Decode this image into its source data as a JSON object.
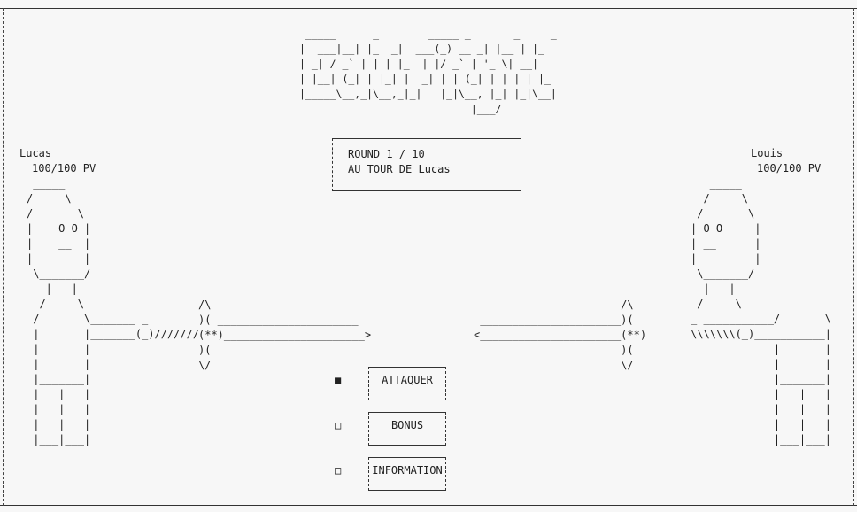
{
  "logo_ascii": " _____      _        _____ _       _     _\n|  ___|__| |_  _|  ___(_) __ _| |__ | |_\n| _| / _` | | | |_  | |/ _` | '_ \\| __|\n| |__| (_| | |_| |  _| | | (_| | | | | |_\n|_____\\__,_|\\__,_|_|   |_|\\__, |_| |_|\\__|\n                            |___/",
  "player_left": {
    "name": "Lucas",
    "hp": "100/100 PV"
  },
  "player_right": {
    "name": "Louis",
    "hp": "100/100 PV"
  },
  "round_box": {
    "line1": "ROUND 1 / 10",
    "line2": "AU TOUR DE Lucas"
  },
  "menu": [
    {
      "label": "ATTAQUER",
      "marker": "■",
      "selected": true
    },
    {
      "label": "BONUS",
      "marker": "□",
      "selected": false
    },
    {
      "label": "INFORMATION",
      "marker": "□",
      "selected": false
    }
  ],
  "art": {
    "left_fighter": " _____\n/     \\\n/       \\\n|    O O |\n|    __  |\n|        |\n \\_______/\n   |   |\n  /     \\\n /       \\_______ _\n |       |_______(_)///////\n |       |\n |       |\n |_______|\n |   |   |\n |   |   |\n |   |   |\n |___|___|",
    "right_fighter": "   _____\n  /     \\\n /       \\\n| O O     |\n| __      |\n|         |\n \\_______/\n  |   |\n /     \\\n_ ___________/       \\\n\\\\\\\\\\\\\\(_)___________|       |\n             |       |\n             |       |\n             |_______|\n             |   |   |\n             |   |   |\n             |   |   |\n             |___|___|",
    "left_sword": "/\\\n)( ______________________\n(**)______________________>\n)(\n\\/",
    "right_sword": "                       /\\\n ______________________)(\n<______________________(**)\n                       )(\n                       \\/"
  }
}
